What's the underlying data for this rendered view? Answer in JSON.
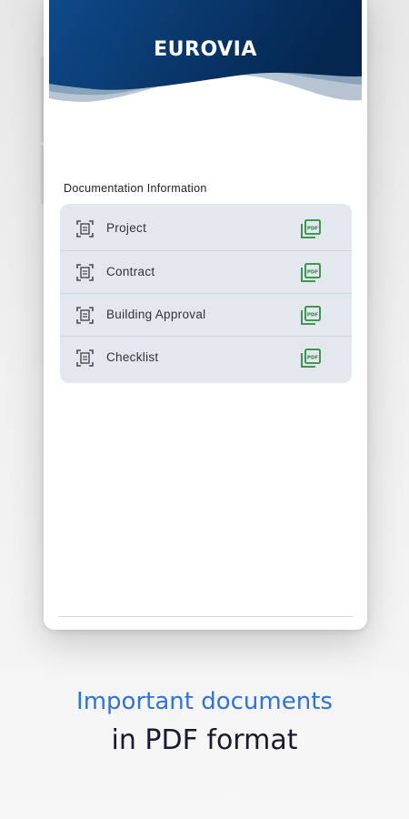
{
  "app": {
    "logo": "EUROVIA",
    "colors": {
      "header_dark": "#04264f",
      "header_mid": "#0f4a8a",
      "card_bg": "#e3e8ef",
      "pdf_green": "#2e8b3a",
      "tagline_blue": "#2f73d8"
    }
  },
  "documentation": {
    "title": "Documentation Information",
    "items": [
      {
        "label": "Project",
        "icon": "document-scan-icon",
        "action_icon": "pdf-icon"
      },
      {
        "label": "Contract",
        "icon": "document-scan-icon",
        "action_icon": "pdf-icon"
      },
      {
        "label": "Building Approval",
        "icon": "document-scan-icon",
        "action_icon": "pdf-icon"
      },
      {
        "label": "Checklist",
        "icon": "document-scan-icon",
        "action_icon": "pdf-icon"
      }
    ]
  },
  "tagline": {
    "line1": "Important documents",
    "line2": "in PDF format"
  }
}
